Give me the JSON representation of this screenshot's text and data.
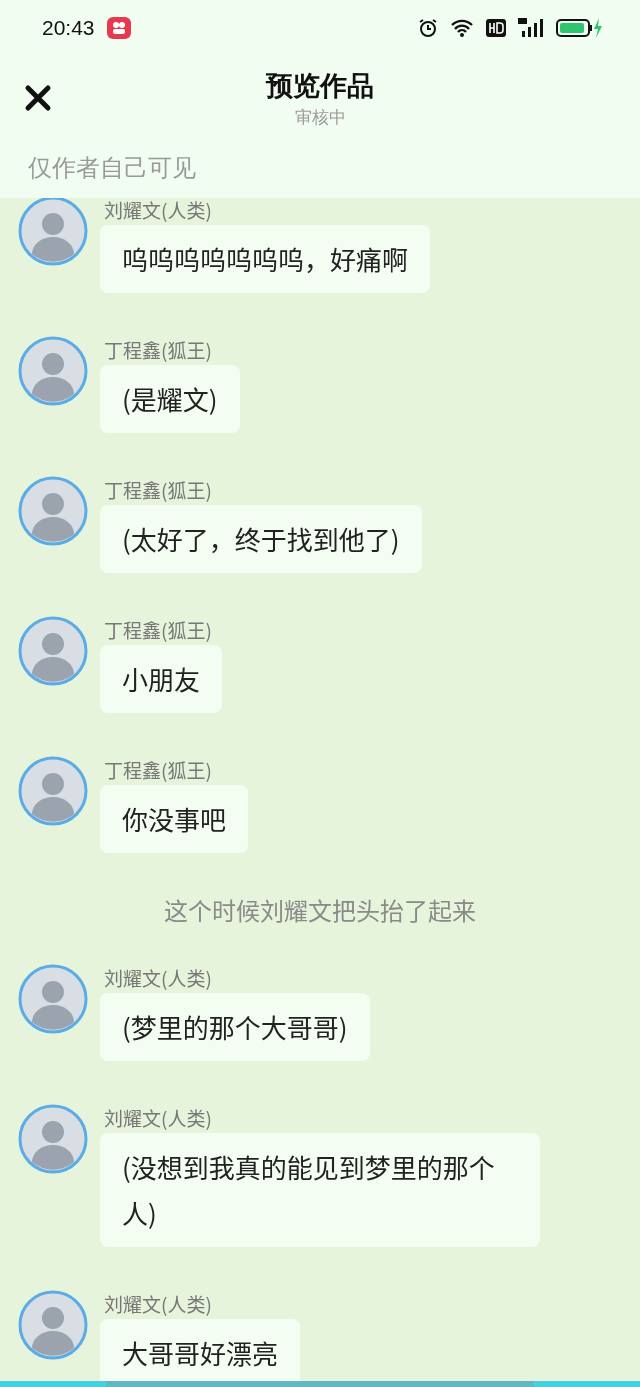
{
  "status_bar": {
    "time": "20:43"
  },
  "header": {
    "title": "预览作品",
    "subtitle": "审核中"
  },
  "notice": "仅作者自己可见",
  "messages": [
    {
      "kind": "message",
      "sender": "刘耀文(人类)",
      "text": "呜呜呜呜呜呜呜，好痛啊"
    },
    {
      "kind": "message",
      "sender": "丁程鑫(狐王)",
      "text": "(是耀文)"
    },
    {
      "kind": "message",
      "sender": "丁程鑫(狐王)",
      "text": "(太好了，终于找到他了)"
    },
    {
      "kind": "message",
      "sender": "丁程鑫(狐王)",
      "text": "小朋友"
    },
    {
      "kind": "message",
      "sender": "丁程鑫(狐王)",
      "text": "你没事吧"
    },
    {
      "kind": "narration",
      "text": "这个时候刘耀文把头抬了起来"
    },
    {
      "kind": "message",
      "sender": "刘耀文(人类)",
      "text": "(梦里的那个大哥哥)"
    },
    {
      "kind": "message",
      "sender": "刘耀文(人类)",
      "text": "(没想到我真的能见到梦里的那个人)"
    },
    {
      "kind": "message",
      "sender": "刘耀文(人类)",
      "text": "大哥哥好漂亮"
    }
  ]
}
